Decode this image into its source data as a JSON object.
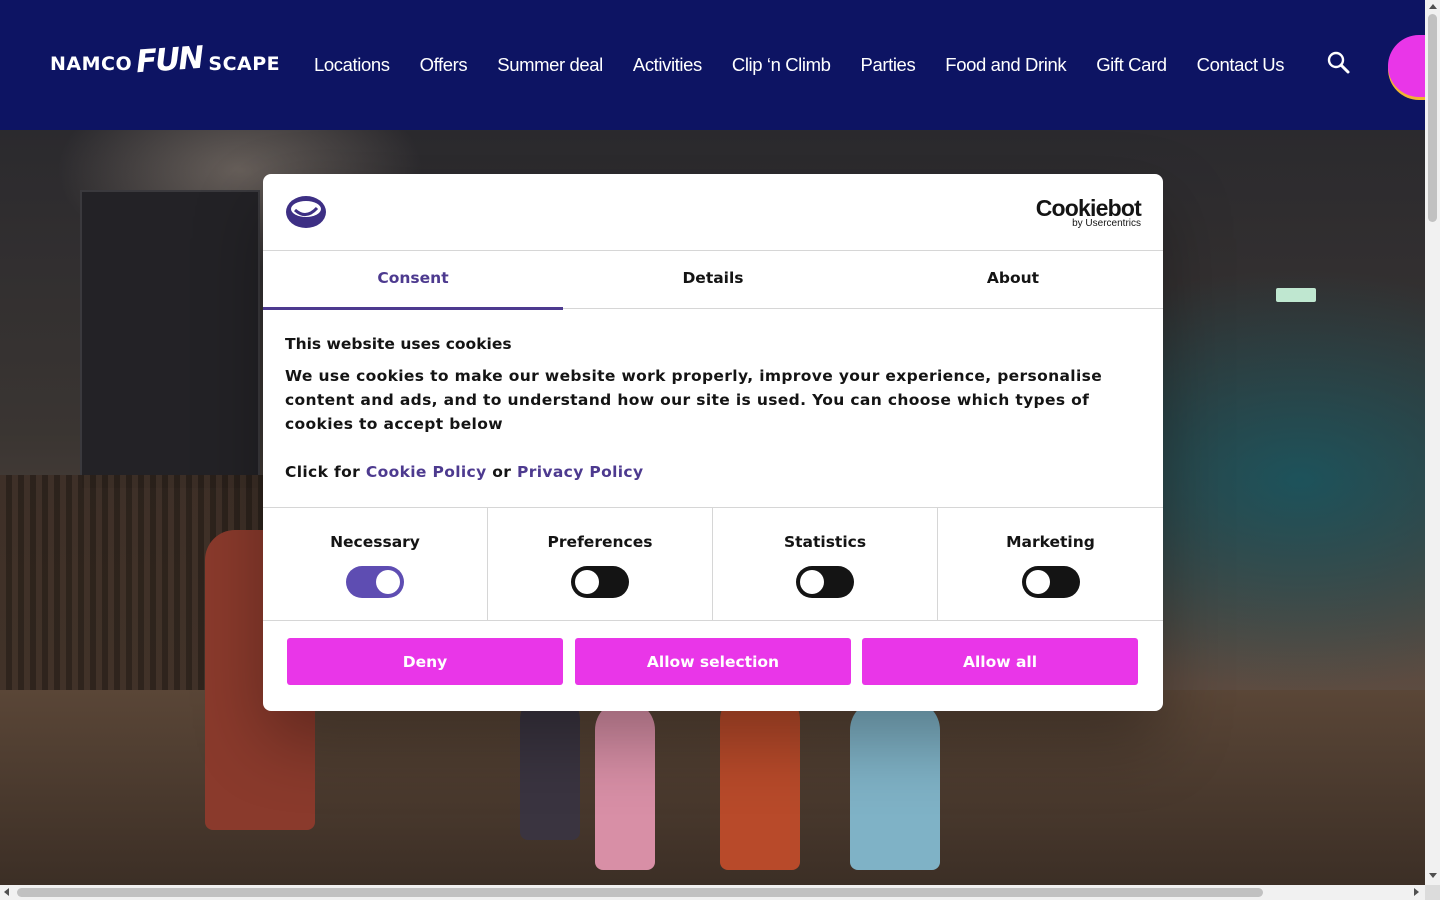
{
  "header": {
    "logo": {
      "word1": "NAMCO",
      "word2": "FUN",
      "word3": "SCAPE"
    },
    "nav": [
      "Locations",
      "Offers",
      "Summer deal",
      "Activities",
      "Clip ‘n Climb",
      "Parties",
      "Food and Drink",
      "Gift Card",
      "Contact Us"
    ],
    "icons": {
      "search": "search-icon"
    }
  },
  "cookie_dialog": {
    "brand_logo": {
      "name": "Cookiebot",
      "sub": "by Usercentrics"
    },
    "tabs": [
      {
        "label": "Consent",
        "active": true
      },
      {
        "label": "Details",
        "active": false
      },
      {
        "label": "About",
        "active": false
      }
    ],
    "heading": "This website uses cookies",
    "body": "We use cookies to make our website work properly, improve your experience, personalise content and ads, and to understand how our site is used. You can choose which types of cookies to accept below",
    "links_line": {
      "prefix": "Click for",
      "link1": "Cookie Policy",
      "middle": "or",
      "link2": "Privacy Policy"
    },
    "categories": [
      {
        "label": "Necessary",
        "enabled": true
      },
      {
        "label": "Preferences",
        "enabled": false
      },
      {
        "label": "Statistics",
        "enabled": false
      },
      {
        "label": "Marketing",
        "enabled": false
      }
    ],
    "buttons": {
      "deny": "Deny",
      "allow_selection": "Allow selection",
      "allow_all": "Allow all"
    },
    "colors": {
      "accent": "#4d3a8f",
      "button": "#e936e8",
      "toggle_on": "#5e4db2",
      "toggle_off": "#141414"
    }
  },
  "colors": {
    "header_bg": "#0d1463"
  }
}
